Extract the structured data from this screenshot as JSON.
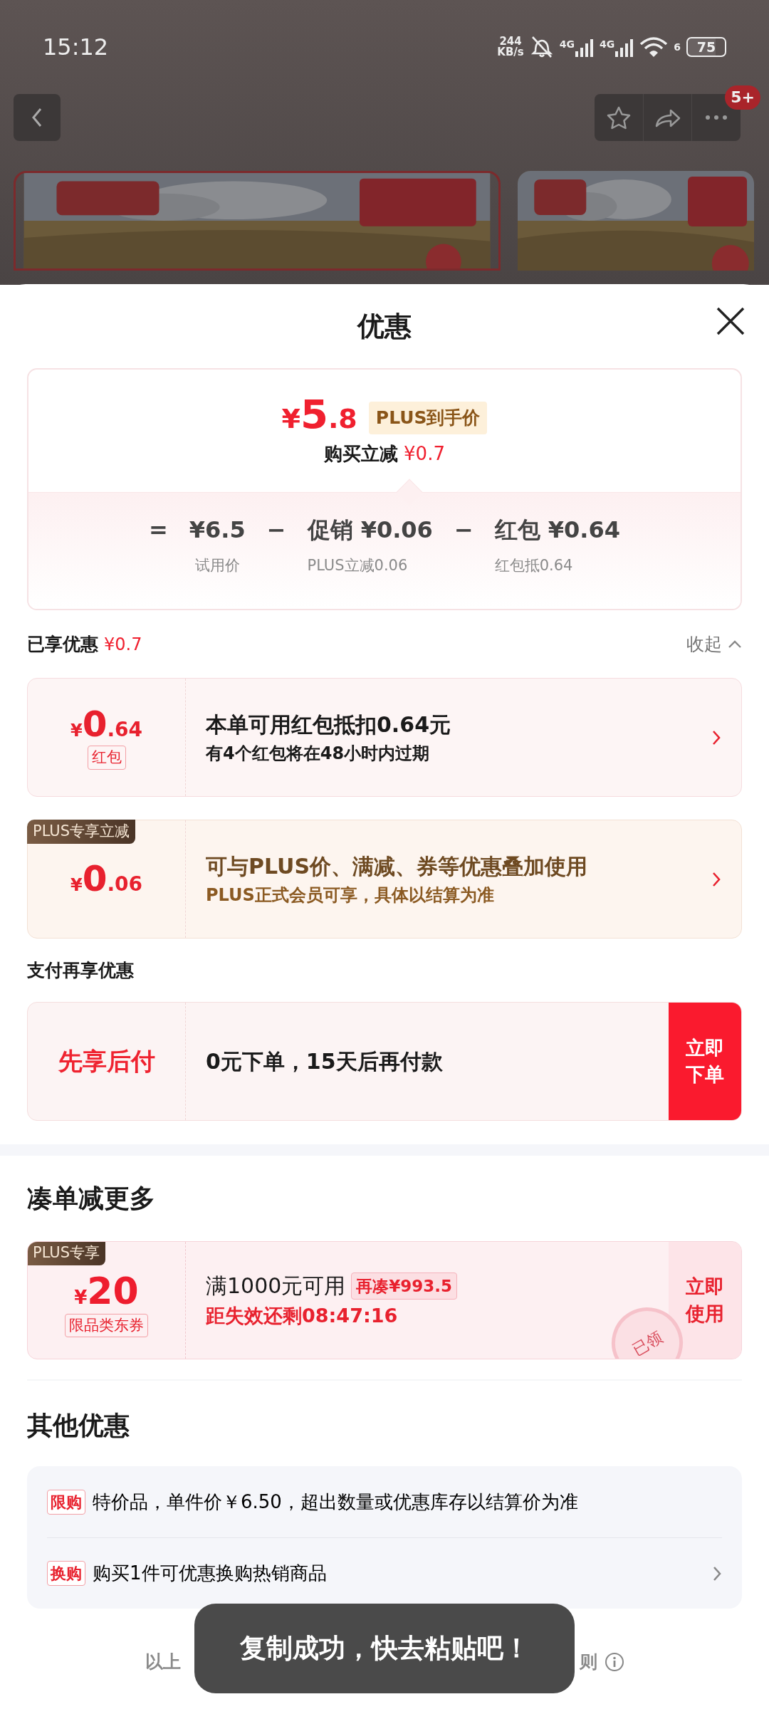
{
  "status_bar": {
    "time": "15:12",
    "net_speed": [
      "244",
      "KB/s"
    ],
    "networks": [
      "4G",
      "4G"
    ],
    "wifi_badge": "6",
    "battery": "75"
  },
  "top_bar": {
    "badge": "5+"
  },
  "sheet": {
    "title": "优惠"
  },
  "price_card": {
    "currency": "¥",
    "integer": "5",
    "decimal": ".8",
    "badge": "PLUS到手价",
    "saving_label": "购买立减",
    "saving_amount": "¥0.7",
    "formula": [
      {
        "kind": "operator",
        "text": "="
      },
      {
        "kind": "term",
        "value": "¥6.5",
        "caption": "试用价"
      },
      {
        "kind": "operator",
        "text": "−"
      },
      {
        "kind": "term",
        "value": "促销 ¥0.06",
        "caption": "PLUS立减0.06"
      },
      {
        "kind": "operator",
        "text": "−"
      },
      {
        "kind": "term",
        "value": "红包 ¥0.64",
        "caption": "红包抵0.64"
      }
    ]
  },
  "enjoyed": {
    "label": "已享优惠",
    "amount": "¥0.7",
    "toggle": "收起",
    "expanded": true
  },
  "offers": [
    {
      "kind": "redpacket",
      "currency": "¥",
      "integer": "0",
      "decimal": ".64",
      "tag": "红包",
      "title": "本单可用红包抵扣0.64元",
      "subtitle": "有4个红包将在48小时内过期"
    },
    {
      "kind": "plus",
      "ribbon": "PLUS专享立减",
      "currency": "¥",
      "integer": "0",
      "decimal": ".06",
      "title": "可与PLUS价、满减、券等优惠叠加使用",
      "subtitle": "PLUS正式会员可享，具体以结算为准"
    }
  ],
  "pay_section": {
    "heading": "支付再享优惠",
    "label": "先享后付",
    "text": "0元下单，15天后再付款",
    "button": "立即下单"
  },
  "bundle": {
    "heading": "凑单减更多",
    "coupon": {
      "ribbon": "PLUS专享",
      "currency": "¥",
      "amount": "20",
      "tag": "限品类东券",
      "condition": "满1000元可用",
      "extra_tag": "再凑¥993.5",
      "countdown": "距失效还剩08:47:16",
      "button": "立即使用",
      "stamp": "已领"
    }
  },
  "others": {
    "heading": "其他优惠",
    "items": [
      {
        "tag": "限购",
        "text": "特价品，单件价￥6.50，超出数量或优惠库存以结算价为准",
        "chevron": false
      },
      {
        "tag": "换购",
        "text": "购买1件可优惠换购热销商品",
        "chevron": true
      }
    ]
  },
  "footer": {
    "text_left": "以上",
    "text_right": "则"
  },
  "toast": {
    "text": "复制成功，快去粘贴吧！"
  }
}
